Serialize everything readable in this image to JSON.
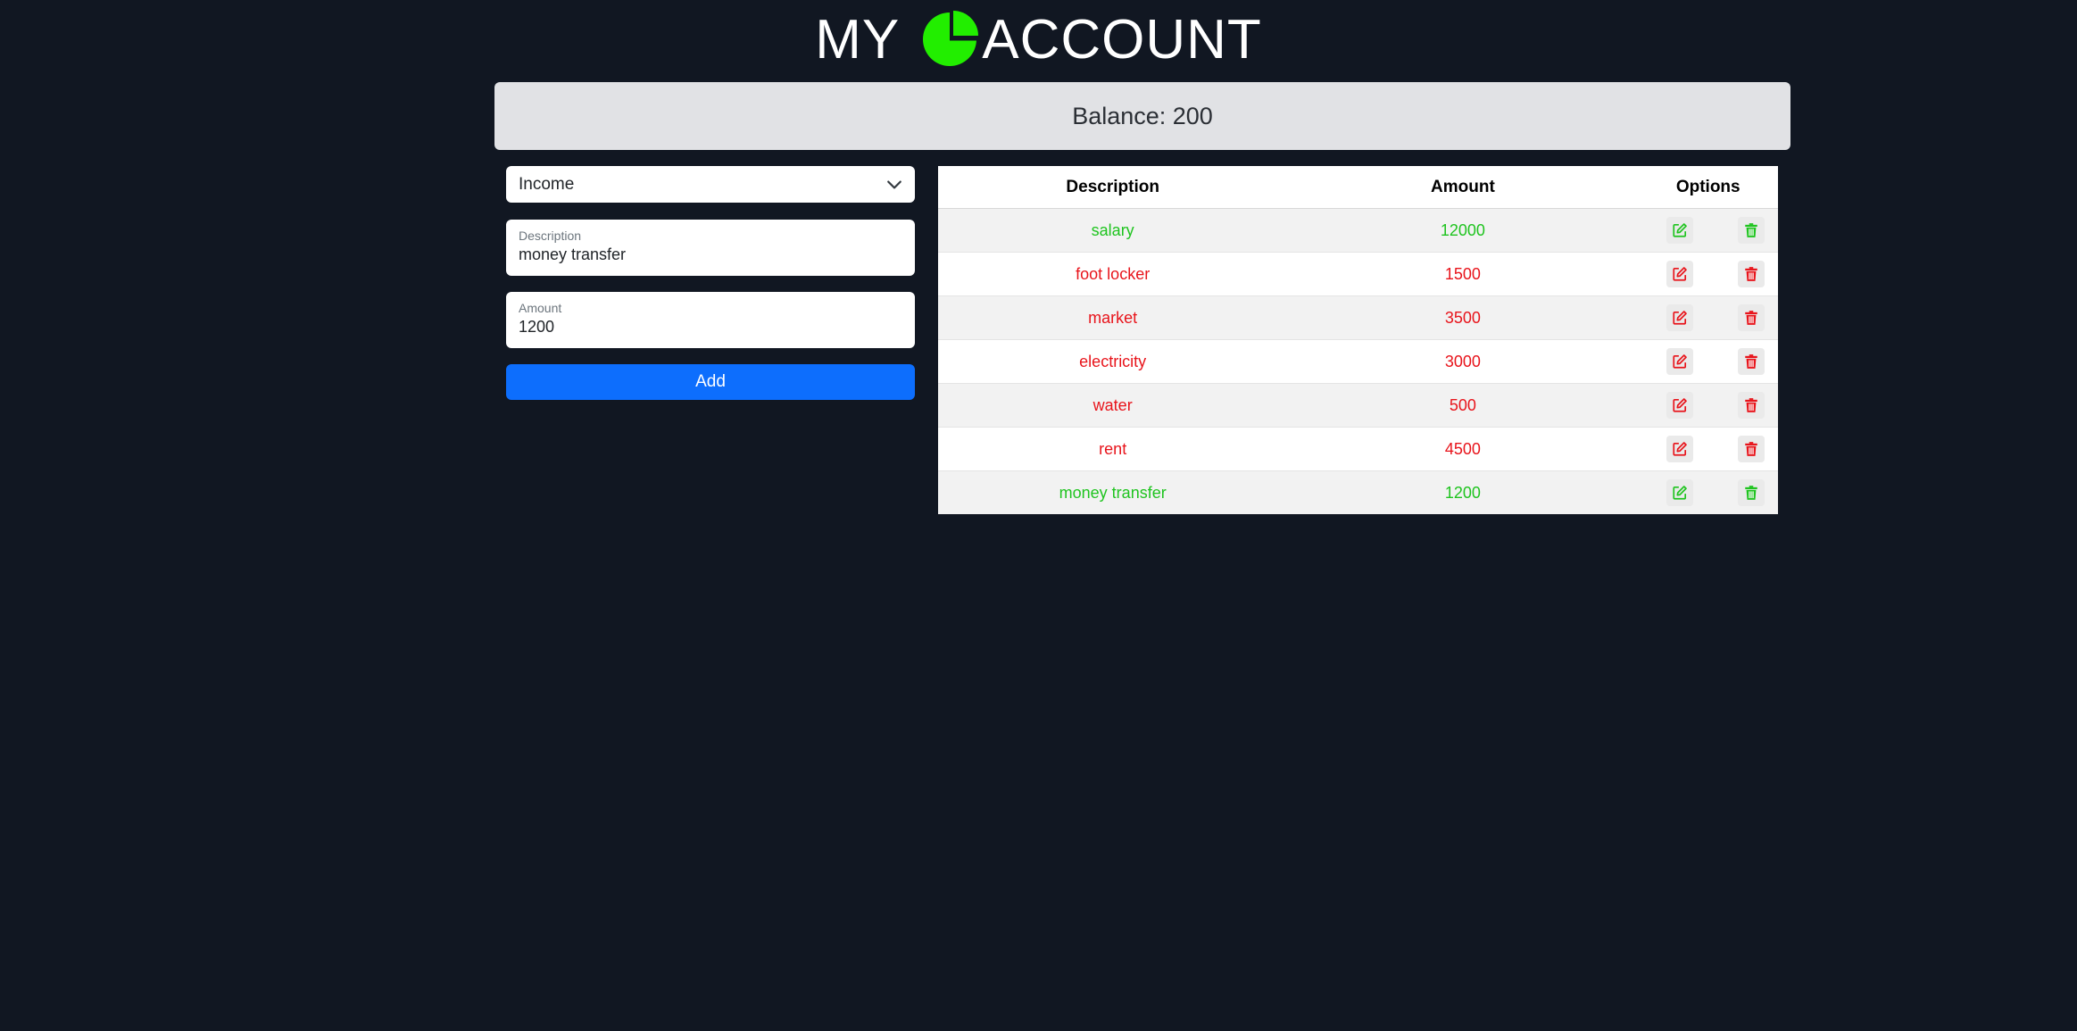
{
  "header": {
    "title_left": "MY",
    "title_right": "ACCOUNT",
    "logo_icon": "pie-chart-icon",
    "logo_color": "#22ee00"
  },
  "balance": {
    "text": "Balance: 200"
  },
  "form": {
    "type_select": {
      "value": "Income"
    },
    "description": {
      "label": "Description",
      "value": "money transfer"
    },
    "amount": {
      "label": "Amount",
      "value": "1200"
    },
    "add_label": "Add"
  },
  "table": {
    "headers": [
      "Description",
      "Amount",
      "Options"
    ],
    "rows": [
      {
        "description": "salary",
        "amount": "12000",
        "kind": "income"
      },
      {
        "description": "foot locker",
        "amount": "1500",
        "kind": "expense"
      },
      {
        "description": "market",
        "amount": "3500",
        "kind": "expense"
      },
      {
        "description": "electricity",
        "amount": "3000",
        "kind": "expense"
      },
      {
        "description": "water",
        "amount": "500",
        "kind": "expense"
      },
      {
        "description": "rent",
        "amount": "4500",
        "kind": "expense"
      },
      {
        "description": "money transfer",
        "amount": "1200",
        "kind": "income"
      }
    ],
    "edit_icon": "edit-icon",
    "delete_icon": "trash-icon"
  },
  "colors": {
    "income": "#1fc41f",
    "expense": "#e8141b",
    "primary": "#0d6efd",
    "background": "#111722"
  }
}
